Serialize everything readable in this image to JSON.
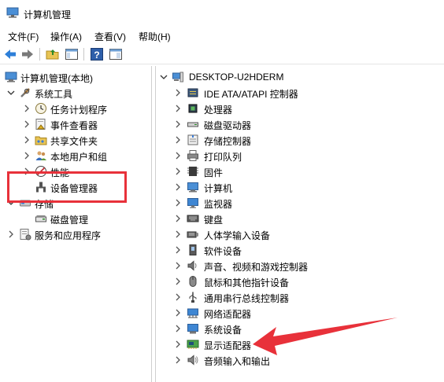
{
  "window": {
    "title": "计算机管理"
  },
  "menubar": {
    "items": [
      "文件(F)",
      "操作(A)",
      "查看(V)",
      "帮助(H)"
    ]
  },
  "colors": {
    "highlight": "#e8313a",
    "arrow": "#e8313a"
  },
  "left_tree": {
    "root": "计算机管理(本地)",
    "system_tools": "系统工具",
    "task_scheduler": "任务计划程序",
    "event_viewer": "事件查看器",
    "shared_folders": "共享文件夹",
    "local_users": "本地用户和组",
    "performance": "性能",
    "device_manager": "设备管理器",
    "storage": "存储",
    "disk_management": "磁盘管理",
    "services_apps": "服务和应用程序"
  },
  "right_tree": {
    "computer_name": "DESKTOP-U2HDERM",
    "categories": [
      {
        "label": "IDE ATA/ATAPI 控制器",
        "icon": "ide-controller-icon"
      },
      {
        "label": "处理器",
        "icon": "processor-icon"
      },
      {
        "label": "磁盘驱动器",
        "icon": "disk-drive-icon"
      },
      {
        "label": "存储控制器",
        "icon": "storage-controller-icon"
      },
      {
        "label": "打印队列",
        "icon": "printer-icon"
      },
      {
        "label": "固件",
        "icon": "firmware-icon"
      },
      {
        "label": "计算机",
        "icon": "computer-icon"
      },
      {
        "label": "监视器",
        "icon": "monitor-icon"
      },
      {
        "label": "键盘",
        "icon": "keyboard-icon"
      },
      {
        "label": "人体学输入设备",
        "icon": "hid-icon"
      },
      {
        "label": "软件设备",
        "icon": "software-device-icon"
      },
      {
        "label": "声音、视频和游戏控制器",
        "icon": "sound-icon"
      },
      {
        "label": "鼠标和其他指针设备",
        "icon": "mouse-icon"
      },
      {
        "label": "通用串行总线控制器",
        "icon": "usb-icon"
      },
      {
        "label": "网络适配器",
        "icon": "network-adapter-icon"
      },
      {
        "label": "系统设备",
        "icon": "system-device-icon"
      },
      {
        "label": "显示适配器",
        "icon": "display-adapter-icon"
      },
      {
        "label": "音频输入和输出",
        "icon": "audio-io-icon"
      }
    ]
  }
}
